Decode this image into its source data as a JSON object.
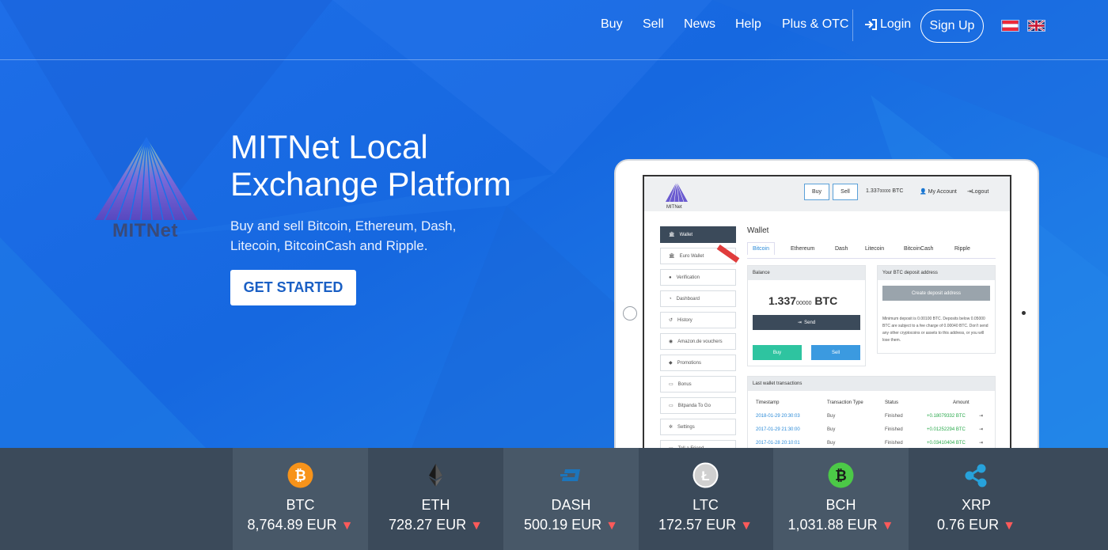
{
  "nav": {
    "links": [
      "Buy",
      "Sell",
      "News",
      "Help",
      "Plus & OTC"
    ],
    "login": "Login",
    "signup": "Sign Up"
  },
  "hero": {
    "logo_text": "MITNet",
    "title": "MITNet Local Exchange Platform",
    "subtitle": "Buy and sell Bitcoin, Ethereum, Dash, Litecoin, BitcoinCash and Ripple.",
    "cta": "GET STARTED"
  },
  "tablet": {
    "logo_text": "MITNet",
    "top_buy": "Buy",
    "top_sell": "Sell",
    "top_balance": "1.337",
    "top_balance_small": "00000",
    "top_balance_unit": "BTC",
    "my_account": "My Account",
    "logout": "Logout",
    "sidebar": [
      "Wallet",
      "Euro Wallet",
      "Verification",
      "Dashboard",
      "History",
      "Amazon.de vouchers",
      "Promotions",
      "Bonus",
      "Bitpanda To Go",
      "Settings",
      "Tell a Friend"
    ],
    "wallet_title": "Wallet",
    "coin_tabs": [
      "Bitcoin",
      "Ethereum",
      "Dash",
      "Litecoin",
      "BitcoinCash",
      "Ripple"
    ],
    "balance_header": "Balance",
    "balance_main": "1.337",
    "balance_small": "00000",
    "balance_unit": "BTC",
    "send_label": "Send",
    "buy_label": "Buy",
    "sell_label": "Sell",
    "deposit_header": "Your BTC deposit address",
    "deposit_button": "Create deposit address",
    "deposit_note": "Minimum deposit is 0.00100 BTC. Deposits below 0.05000 BTC are subject to a fee charge of 0.00040 BTC. Don't send any other cryptocoins or assets to this address, or you will lose them.",
    "tx_header": "Last wallet transactions",
    "tx_columns": [
      "Timestamp",
      "Transaction Type",
      "Status",
      "Amount"
    ],
    "tx_rows": [
      {
        "time": "2018-01-29 20:30:03",
        "type": "Buy",
        "status": "Finished",
        "amount": "+0.18079332 BTC"
      },
      {
        "time": "2017-01-29 21:30:00",
        "type": "Buy",
        "status": "Finished",
        "amount": "+0.01252294 BTC"
      },
      {
        "time": "2017-01-28 20:10:01",
        "type": "Buy",
        "status": "Finished",
        "amount": "+0.03410404 BTC"
      }
    ]
  },
  "ticker": [
    {
      "symbol": "BTC",
      "price": "8,764.89 EUR",
      "icon": "bitcoin-icon",
      "color": "#f7931a"
    },
    {
      "symbol": "ETH",
      "price": "728.27 EUR",
      "icon": "ethereum-icon",
      "color": "#3c3c3d"
    },
    {
      "symbol": "DASH",
      "price": "500.19 EUR",
      "icon": "dash-icon",
      "color": "#1c75bc"
    },
    {
      "symbol": "LTC",
      "price": "172.57 EUR",
      "icon": "litecoin-icon",
      "color": "#b8b8b8"
    },
    {
      "symbol": "BCH",
      "price": "1,031.88 EUR",
      "icon": "bitcoincash-icon",
      "color": "#4cc947"
    },
    {
      "symbol": "XRP",
      "price": "0.76 EUR",
      "icon": "ripple-icon",
      "color": "#27a2db"
    }
  ],
  "trend_arrow": "▼"
}
